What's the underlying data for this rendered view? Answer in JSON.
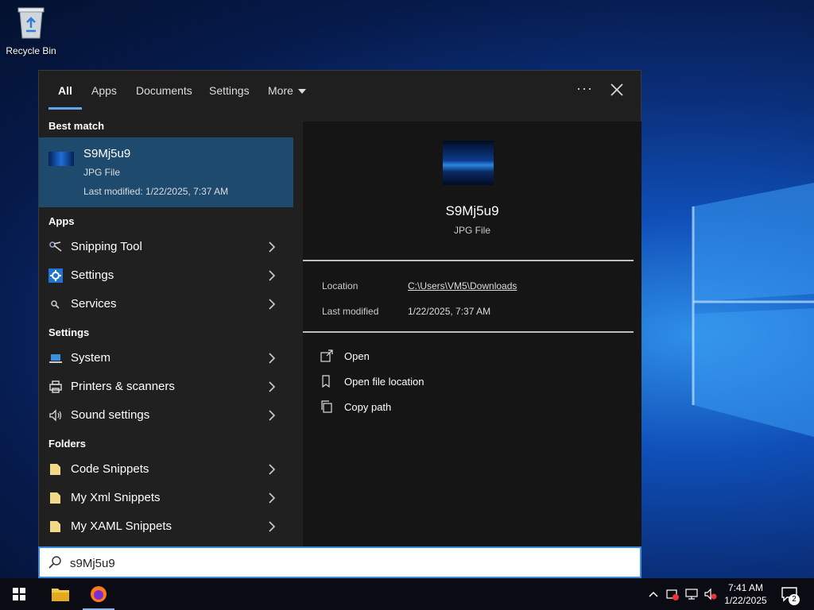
{
  "desktop": {
    "recycle_bin_label": "Recycle Bin"
  },
  "tabs": [
    {
      "label": "All",
      "active": true
    },
    {
      "label": "Apps"
    },
    {
      "label": "Documents"
    },
    {
      "label": "Settings"
    },
    {
      "label": "More"
    }
  ],
  "header": {
    "more_options": "···"
  },
  "best_match": {
    "heading": "Best match",
    "name": "S9Mj5u9",
    "type": "JPG File",
    "modified": "Last modified: 1/22/2025, 7:37 AM"
  },
  "apps": {
    "heading": "Apps",
    "items": [
      {
        "label": "Snipping Tool",
        "icon": "scissors-icon"
      },
      {
        "label": "Settings",
        "icon": "gear-icon"
      },
      {
        "label": "Services",
        "icon": "services-icon"
      }
    ]
  },
  "settings": {
    "heading": "Settings",
    "items": [
      {
        "label": "System",
        "icon": "laptop-icon"
      },
      {
        "label": "Printers & scanners",
        "icon": "printer-icon"
      },
      {
        "label": "Sound settings",
        "icon": "speaker-icon"
      }
    ]
  },
  "folders": {
    "heading": "Folders",
    "items": [
      {
        "label": "Code Snippets",
        "icon": "folder-icon"
      },
      {
        "label": "My Xml Snippets",
        "icon": "folder-icon"
      },
      {
        "label": "My XAML Snippets",
        "icon": "folder-icon"
      }
    ]
  },
  "preview": {
    "title": "S9Mj5u9",
    "subtitle": "JPG File",
    "location_label": "Location",
    "location_value": "C:\\Users\\VM5\\Downloads",
    "modified_label": "Last modified",
    "modified_value": "1/22/2025, 7:37 AM",
    "actions": [
      {
        "label": "Open",
        "icon": "open-icon"
      },
      {
        "label": "Open file location",
        "icon": "file-location-icon"
      },
      {
        "label": "Copy path",
        "icon": "copy-icon"
      }
    ]
  },
  "search": {
    "query": "s9Mj5u9"
  },
  "taskbar": {
    "time": "7:41 AM",
    "date": "1/22/2025",
    "notification_count": "2"
  },
  "colors": {
    "accent": "#5da9f0",
    "selection": "#1e4a6e",
    "panel": "#202020",
    "preview": "#151515"
  }
}
